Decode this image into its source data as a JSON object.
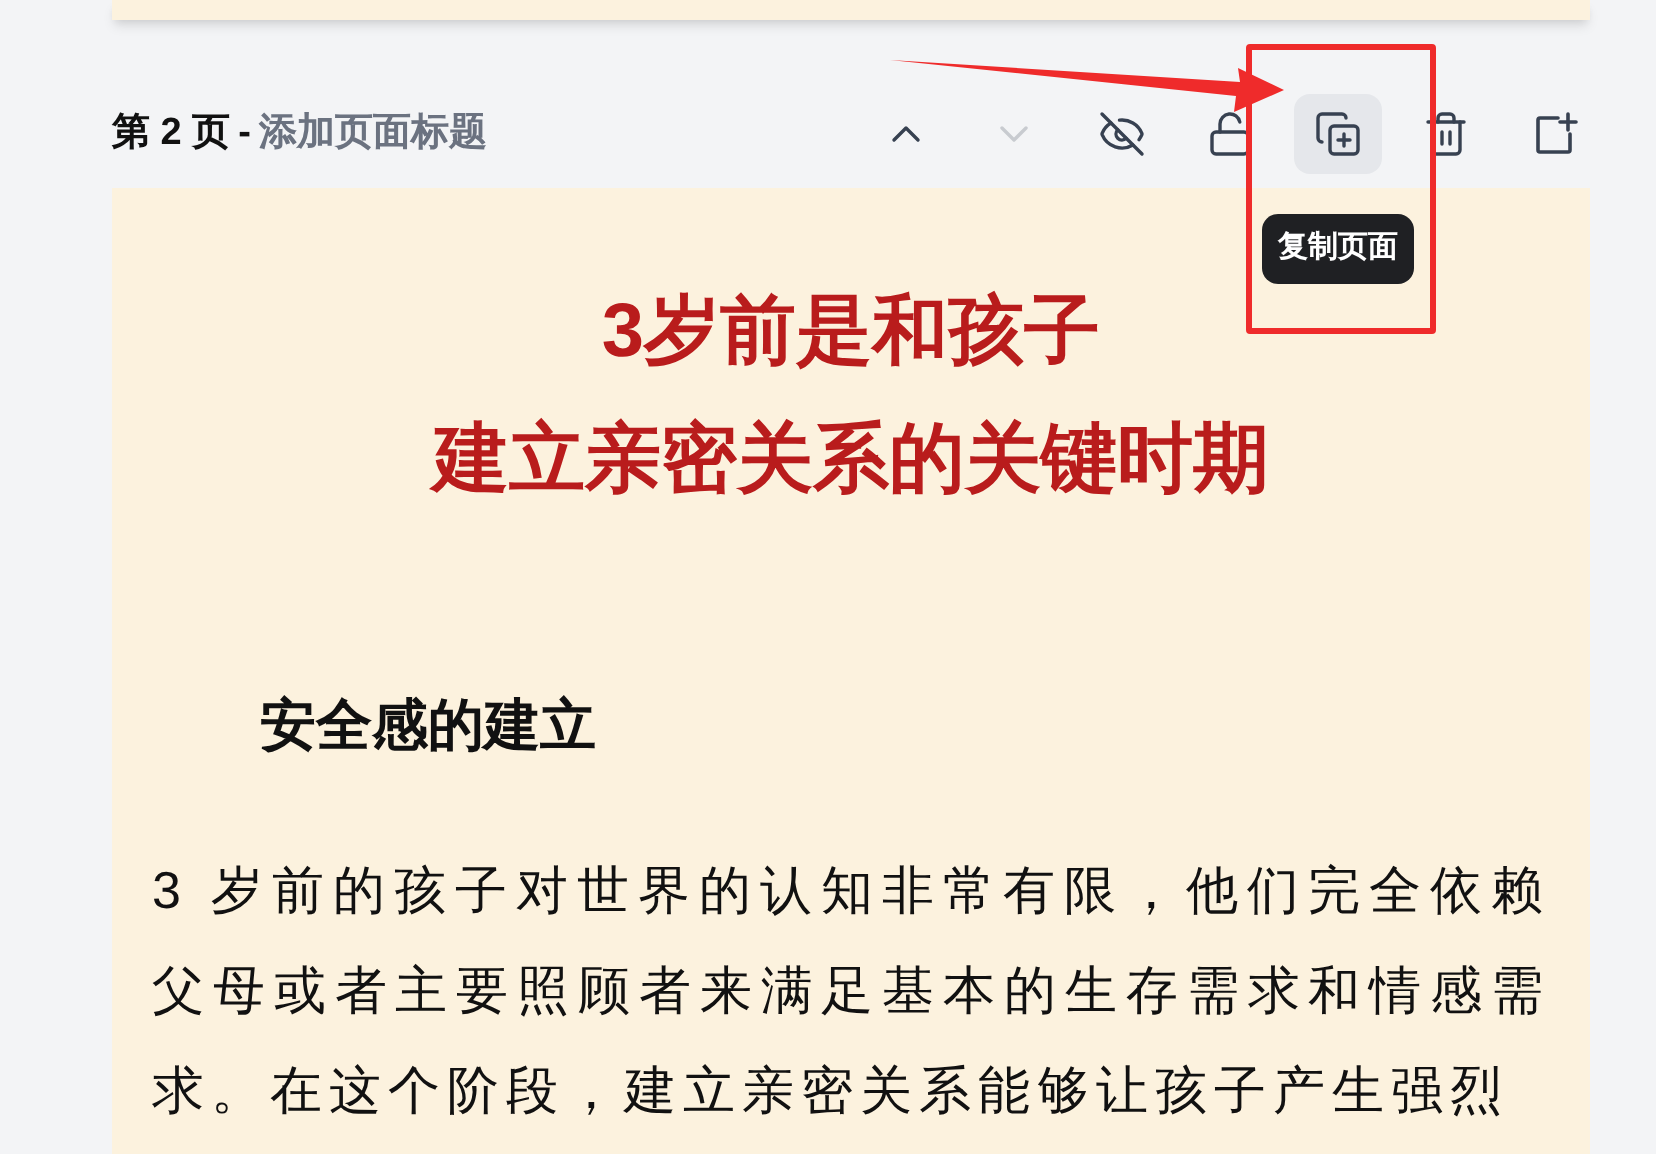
{
  "page_header": {
    "page_label": "第 2 页",
    "separator": "-",
    "title_placeholder": "添加页面标题"
  },
  "toolbar": [
    {
      "kind": "up",
      "disabled": false,
      "hovered": false
    },
    {
      "kind": "down",
      "disabled": true,
      "hovered": false
    },
    {
      "kind": "hide",
      "disabled": false,
      "hovered": false
    },
    {
      "kind": "lock",
      "disabled": false,
      "hovered": false
    },
    {
      "kind": "copy",
      "disabled": false,
      "hovered": true,
      "tooltip": "复制页面"
    },
    {
      "kind": "delete",
      "disabled": false,
      "hovered": false
    },
    {
      "kind": "add",
      "disabled": false,
      "hovered": false
    }
  ],
  "page": {
    "title_lines": [
      "3岁前是和孩子",
      "建立亲密关系的关键时期"
    ],
    "heading": "安全感的建立",
    "paragraph": "3 岁前的孩子对世界的认知非常有限，他们完全依赖父母或者主要照顾者来满足基本的生存需求和情感需求。在这个阶段，建立亲密关系能够让孩子产生强烈"
  }
}
